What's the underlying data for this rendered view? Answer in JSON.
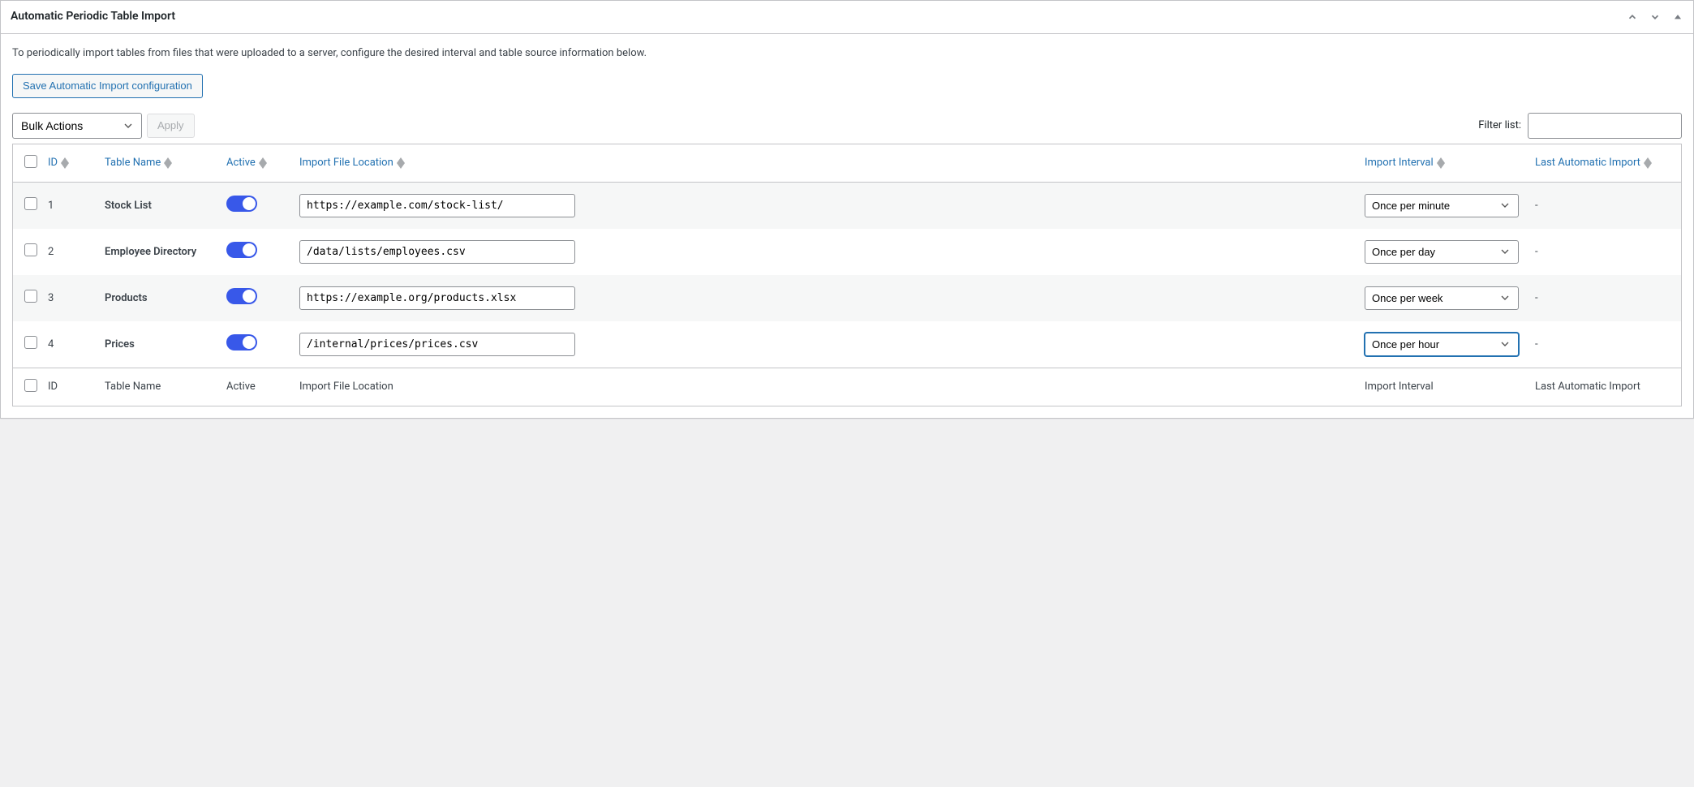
{
  "panel": {
    "title": "Automatic Periodic Table Import",
    "description": "To periodically import tables from files that were uploaded to a server, configure the desired interval and table source information below.",
    "save_button": "Save Automatic Import configuration"
  },
  "toolbar": {
    "bulk_actions_label": "Bulk Actions",
    "apply_label": "Apply",
    "filter_label": "Filter list:",
    "filter_value": ""
  },
  "columns": {
    "id": "ID",
    "name": "Table Name",
    "active": "Active",
    "location": "Import File Location",
    "interval": "Import Interval",
    "last": "Last Automatic Import"
  },
  "interval_options": [
    "Once per minute",
    "Once per hour",
    "Once per day",
    "Once per week"
  ],
  "rows": [
    {
      "id": "1",
      "name": "Stock List",
      "active": true,
      "location": "https://example.com/stock-list/",
      "interval": "Once per minute",
      "last": "-",
      "highlighted": false
    },
    {
      "id": "2",
      "name": "Employee Directory",
      "active": true,
      "location": "/data/lists/employees.csv",
      "interval": "Once per day",
      "last": "-",
      "highlighted": false
    },
    {
      "id": "3",
      "name": "Products",
      "active": true,
      "location": "https://example.org/products.xlsx",
      "interval": "Once per week",
      "last": "-",
      "highlighted": false
    },
    {
      "id": "4",
      "name": "Prices",
      "active": true,
      "location": "/internal/prices/prices.csv",
      "interval": "Once per hour",
      "last": "-",
      "highlighted": true
    }
  ]
}
